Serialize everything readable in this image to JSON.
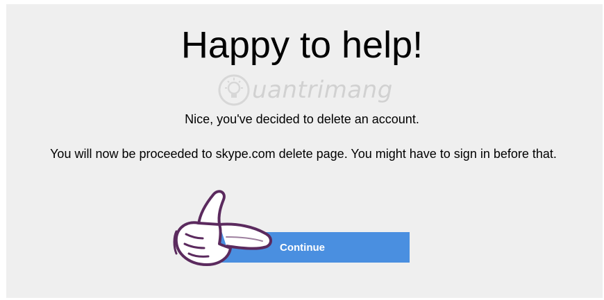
{
  "heading": "Happy to help!",
  "watermark": {
    "text": "uantrimang",
    "icon": "lightbulb-icon"
  },
  "message": {
    "line1": "Nice, you've decided to delete an account.",
    "line2": "You will now be proceeded to skype.com delete page. You might have to sign in before that."
  },
  "continue_button": {
    "label": "Continue"
  },
  "colors": {
    "button": "#4a8fe0",
    "panel": "#efefef",
    "hand_outline": "#5b2a5e"
  }
}
